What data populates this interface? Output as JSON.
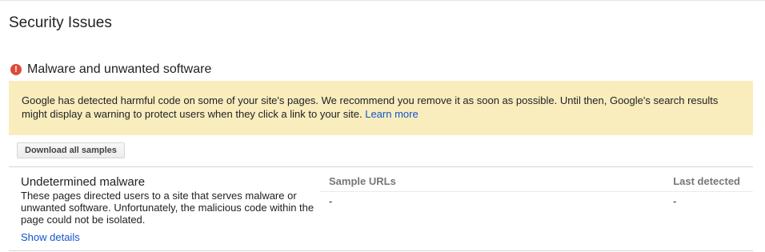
{
  "page": {
    "title": "Security Issues"
  },
  "section": {
    "icon": "error-icon",
    "icon_glyph": "!",
    "title": "Malware and unwanted software"
  },
  "warning": {
    "text": "Google has detected harmful code on some of your site's pages. We recommend you remove it as soon as possible. Until then, Google's search results might display a warning to protect users when they click a link to your site.",
    "link_label": "Learn more",
    "background_color": "#f9edbe",
    "link_color": "#1155cc"
  },
  "toolbar": {
    "download_label": "Download all samples"
  },
  "table": {
    "columns": [
      "Sample URLs",
      "Last detected"
    ],
    "issue": {
      "title": "Undetermined malware",
      "description": "These pages directed users to a site that serves malware or unwanted software. Unfortunately, the malicious code within the page could not be isolated.",
      "show_details_label": "Show details",
      "sample_urls": "-",
      "last_detected": "-"
    }
  },
  "colors": {
    "error_icon": "#dd4b39",
    "link": "#1155cc"
  }
}
